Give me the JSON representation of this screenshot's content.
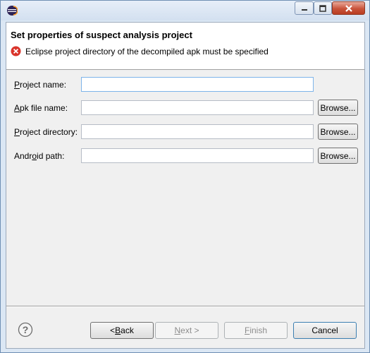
{
  "window": {
    "accent": "#6f8fb3"
  },
  "header": {
    "title": "Set properties of suspect analysis project",
    "error_message": "Eclipse project directory of the decompiled apk must be specified",
    "error_color": "#d9342b"
  },
  "form": {
    "rows": [
      {
        "label_mnemonic": "P",
        "label_rest": "roject name:",
        "value": "",
        "has_browse": false
      },
      {
        "label_mnemonic": "A",
        "label_rest": "pk file name:",
        "value": "",
        "has_browse": true
      },
      {
        "label_mnemonic": "P",
        "label_rest": "roject directory:",
        "value": "",
        "has_browse": true
      },
      {
        "label_pre": "Andr",
        "label_mnemonic": "o",
        "label_rest": "id path:",
        "value": "",
        "has_browse": true
      }
    ],
    "browse_label": "Browse..."
  },
  "footer": {
    "back": {
      "pre": "< ",
      "mnemonic": "B",
      "rest": "ack"
    },
    "next": {
      "pre": "",
      "mnemonic": "N",
      "rest": "ext >"
    },
    "finish": {
      "pre": "",
      "mnemonic": "F",
      "rest": "inish"
    },
    "cancel": "Cancel"
  }
}
